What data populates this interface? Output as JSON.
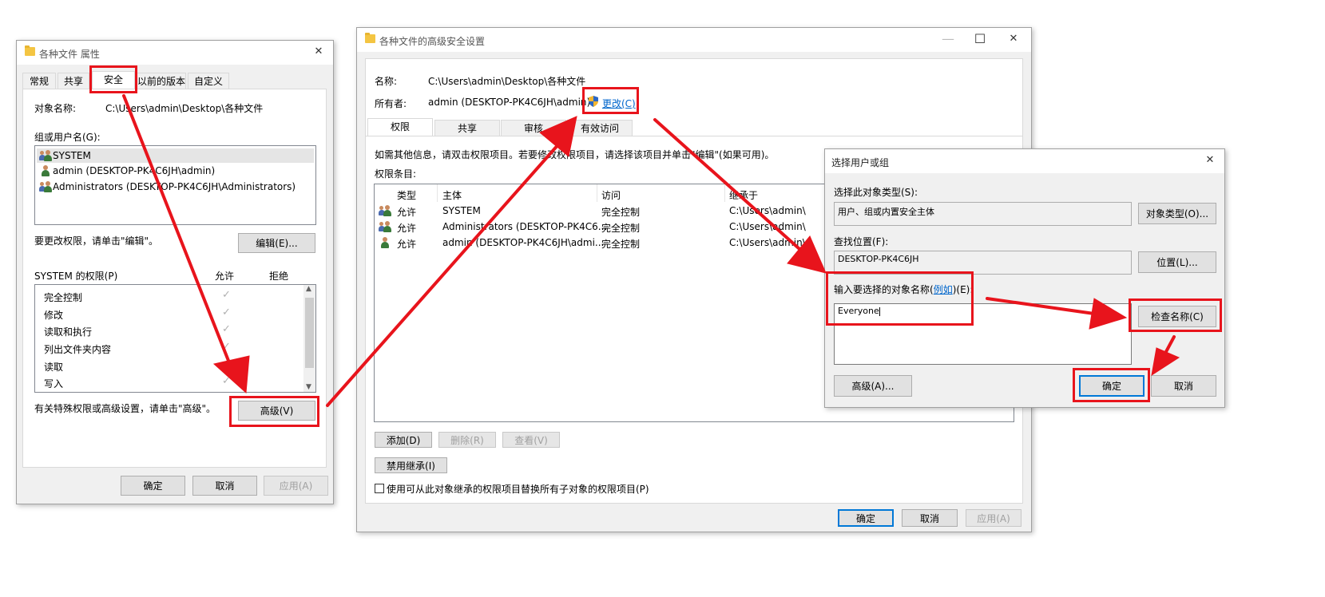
{
  "props": {
    "title": "各种文件 属性",
    "close": "✕",
    "tabs": [
      "常规",
      "共享",
      "安全",
      "以前的版本",
      "自定义"
    ],
    "object_name_label": "对象名称:",
    "object_name_value": "C:\\Users\\admin\\Desktop\\各种文件",
    "groups_label": "组或用户名(G):",
    "groups": [
      "SYSTEM",
      "admin (DESKTOP-PK4C6JH\\admin)",
      "Administrators (DESKTOP-PK4C6JH\\Administrators)"
    ],
    "edit_hint": "要更改权限，请单击\"编辑\"。",
    "edit_button": "编辑(E)...",
    "perm_title": "SYSTEM 的权限(P)",
    "allow": "允许",
    "deny": "拒绝",
    "perms": [
      "完全控制",
      "修改",
      "读取和执行",
      "列出文件夹内容",
      "读取",
      "写入"
    ],
    "check": "✓",
    "advanced_hint": "有关特殊权限或高级设置，请单击\"高级\"。",
    "advanced_button": "高级(V)",
    "ok": "确定",
    "cancel": "取消",
    "apply": "应用(A)"
  },
  "advanced": {
    "title": "各种文件的高级安全设置",
    "min": "—",
    "max": "☐",
    "close": "✕",
    "name_label": "名称:",
    "name_value": "C:\\Users\\admin\\Desktop\\各种文件",
    "owner_label": "所有者:",
    "owner_value": "admin (DESKTOP-PK4C6JH\\admin)",
    "change_link": "更改(C)",
    "tabs": [
      "权限",
      "共享",
      "审核",
      "有效访问"
    ],
    "info": "如需其他信息，请双击权限项目。若要修改权限项目，请选择该项目并单击\"编辑\"(如果可用)。",
    "entries_label": "权限条目:",
    "columns": [
      "类型",
      "主体",
      "访问",
      "继承于"
    ],
    "rows": [
      {
        "type": "允许",
        "principal": "SYSTEM",
        "access": "完全控制",
        "inherited": "C:\\Users\\admin\\"
      },
      {
        "type": "允许",
        "principal": "Administrators (DESKTOP-PK4C6...",
        "access": "完全控制",
        "inherited": "C:\\Users\\admin\\"
      },
      {
        "type": "允许",
        "principal": "admin (DESKTOP-PK4C6JH\\admi...",
        "access": "完全控制",
        "inherited": "C:\\Users\\admin\\"
      }
    ],
    "add": "添加(D)",
    "remove": "删除(R)",
    "view": "查看(V)",
    "disable_inherit": "禁用继承(I)",
    "replace_label": "使用可从此对象继承的权限项目替换所有子对象的权限项目(P)",
    "ok": "确定",
    "cancel": "取消",
    "apply": "应用(A)"
  },
  "select": {
    "title": "选择用户或组",
    "close": "✕",
    "obj_type_label": "选择此对象类型(S):",
    "obj_type_value": "用户、组或内置安全主体",
    "obj_type_button": "对象类型(O)...",
    "location_label": "查找位置(F):",
    "location_value": "DESKTOP-PK4C6JH",
    "location_button": "位置(L)...",
    "enter_label_pre": "输入要选择的对象名称(",
    "enter_label_link": "例如",
    "enter_label_post": ")(E):",
    "input_value": "Everyone",
    "check_names": "检查名称(C)",
    "advanced": "高级(A)...",
    "ok": "确定",
    "cancel": "取消"
  },
  "colors": {
    "annotation_red": "#e8141c",
    "link_blue": "#0066cc",
    "focus_blue": "#0078d7"
  }
}
